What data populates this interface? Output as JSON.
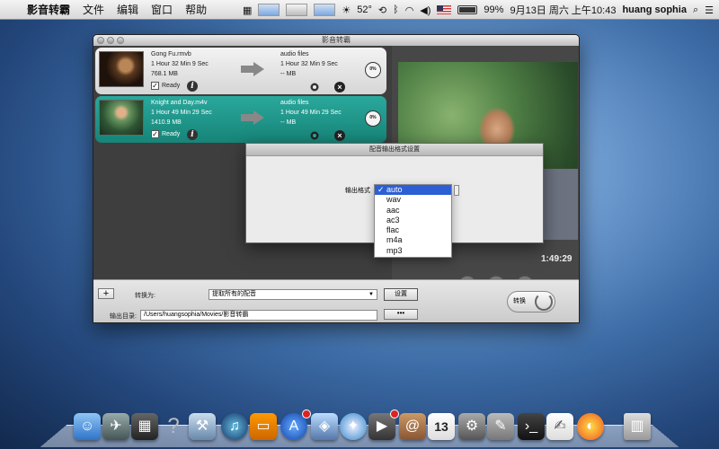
{
  "menubar": {
    "apple_label": "",
    "app_name": "影音转霸",
    "menus": [
      "文件",
      "编辑",
      "窗口",
      "帮助"
    ],
    "temperature": "52°",
    "battery_label": "99%",
    "battery_level": 0.99,
    "datetime": "9月13日 周六 上午10:43",
    "user": "huang sophia"
  },
  "window": {
    "title": "影音转霸",
    "files": [
      {
        "name": "Gong Fu.rmvb",
        "duration": "1 Hour 32 Min 9 Sec",
        "size": "768.1 MB",
        "status": "Ready",
        "output_name": "audio files",
        "output_duration": "1 Hour 32 Min 9 Sec",
        "output_size": "-- MB",
        "progress": "0%"
      },
      {
        "name": "Knight and Day.m4v",
        "duration": "1 Hour 49 Min 29 Sec",
        "size": "1410.9 MB",
        "status": "Ready",
        "output_name": "audio files",
        "output_duration": "1 Hour 49 Min 29 Sec",
        "output_size": "-- MB",
        "progress": "0%"
      }
    ],
    "preview": {
      "timecode": "1:49:29"
    },
    "bottom": {
      "add_label": "+",
      "convert_to_label": "转换为:",
      "convert_to_value": "提取所有的配音",
      "settings_label": "设置",
      "output_dir_label": "输出目录:",
      "output_dir_value": "/Users/huangsophia/Movies/影音转霸",
      "browse_label": "•••",
      "convert_button": "转换"
    }
  },
  "dialog": {
    "title": "配音输出格式设置",
    "format_label": "输出格式",
    "options": [
      "auto",
      "wav",
      "aac",
      "ac3",
      "flac",
      "m4a",
      "mp3"
    ],
    "selected": "auto"
  },
  "dock": {
    "items": [
      "finder-icon",
      "launchpad-icon",
      "mission-control-icon",
      "help-icon",
      "xcode-icon",
      "itunes-icon",
      "ibooks-icon",
      "app-store-icon",
      "preview-icon",
      "safari-icon",
      "facetime-icon",
      "contacts-icon",
      "calendar-icon",
      "system-preferences-icon",
      "terminal-icon",
      "textedit-icon",
      "app-icon",
      "trash-icon"
    ],
    "calendar_day": "13"
  }
}
